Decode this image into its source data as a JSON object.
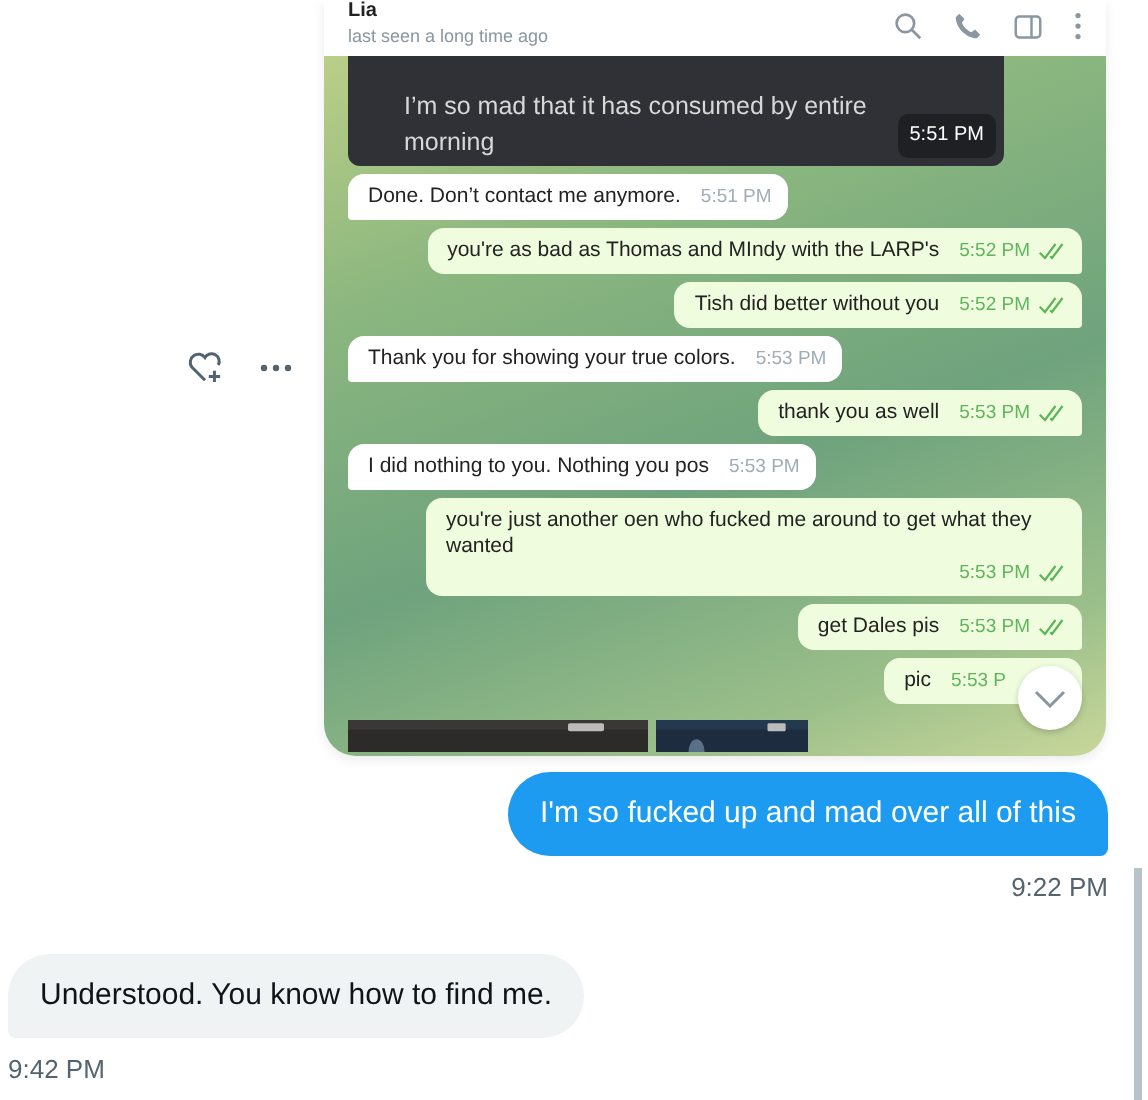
{
  "shared_image": {
    "contact": {
      "name": "Lia",
      "status": "last seen a long time ago"
    },
    "messages": [
      {
        "kind": "dark",
        "text": "I’m so mad that it has consumed by entire morning",
        "time": "5:51 PM"
      },
      {
        "kind": "incoming",
        "text": "Done. Don’t contact me anymore.",
        "time": "5:51 PM"
      },
      {
        "kind": "outgoing",
        "text": "you're as bad as Thomas and MIndy with the LARP's",
        "time": "5:52 PM",
        "read": true
      },
      {
        "kind": "outgoing",
        "text": "Tish did better without you",
        "time": "5:52 PM",
        "read": true
      },
      {
        "kind": "incoming",
        "text": "Thank you for showing your true colors.",
        "time": "5:53 PM"
      },
      {
        "kind": "outgoing",
        "text": "thank you as well",
        "time": "5:53 PM",
        "read": true
      },
      {
        "kind": "incoming",
        "text": "I did nothing to you.  Nothing you pos",
        "time": "5:53 PM"
      },
      {
        "kind": "outgoing",
        "text": "you're just another oen who fucked me around to get what they wanted",
        "time": "5:53 PM",
        "read": true
      },
      {
        "kind": "outgoing",
        "text": "get Dales pis",
        "time": "5:53 PM",
        "read": true
      },
      {
        "kind": "outgoing",
        "text": "pic",
        "time": "5:53 P"
      }
    ]
  },
  "dm_messages": [
    {
      "kind": "sent",
      "text": "I'm so fucked up and mad over all of this",
      "time": "9:22 PM"
    },
    {
      "kind": "received",
      "text": "Understood. You know how to find me.",
      "time": "9:42 PM"
    }
  ]
}
